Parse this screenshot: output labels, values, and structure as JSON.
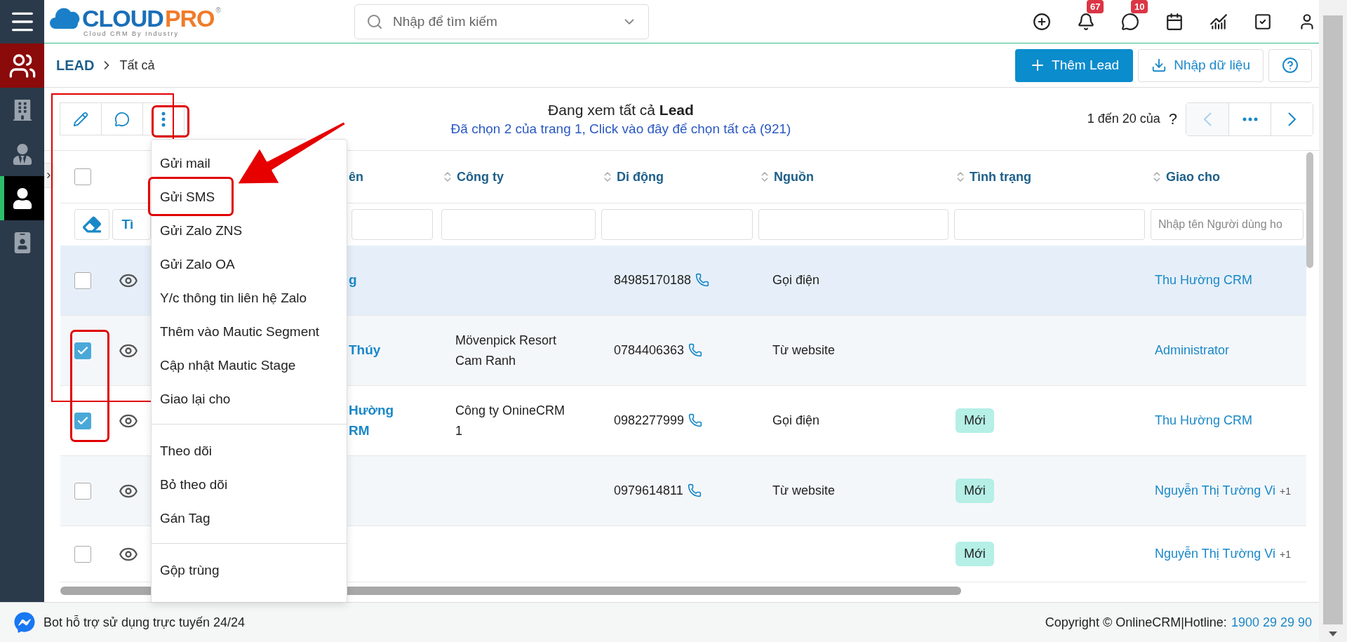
{
  "sidebar": {
    "items": [
      {
        "kind": "module",
        "selected": false
      },
      {
        "kind": "link",
        "selected": false
      },
      {
        "kind": "link",
        "selected": false
      },
      {
        "kind": "link",
        "selected": true
      },
      {
        "kind": "link",
        "selected": false
      }
    ]
  },
  "header": {
    "logo": {
      "brand_1": "CLOUD",
      "brand_2": "PRO",
      "mark": "®",
      "tagline": "Cloud CRM By Industry"
    },
    "search": {
      "placeholder": "Nhập để tìm kiếm"
    },
    "actions": [
      {
        "kind": "add"
      },
      {
        "kind": "notifications",
        "badge": "67"
      },
      {
        "kind": "messages",
        "badge": "10"
      },
      {
        "kind": "calendar"
      },
      {
        "kind": "reports"
      },
      {
        "kind": "tasks"
      },
      {
        "kind": "account"
      }
    ]
  },
  "breadcrumb": {
    "module": "LEAD",
    "current": "Tất cả"
  },
  "page_buttons": {
    "add": "Thêm Lead",
    "import": "Nhập dữ liệu"
  },
  "toolbar": {
    "actions": [
      {
        "kind": "edit"
      },
      {
        "kind": "comment"
      },
      {
        "kind": "more"
      }
    ],
    "viewing": "Đang xem tất cả **Lead**",
    "selection": "Đã chọn 2 của trang 1, Click vào đây để chọn tất cả (921)",
    "range": "1 đến 20 của",
    "total": "?",
    "prev_disabled": true
  },
  "more_menu": {
    "expanded": true,
    "groups": [
      [
        "Gửi mail",
        "Gửi SMS",
        "Gửi Zalo ZNS",
        "Gửi Zalo OA",
        "Y/c thông tin liên hệ Zalo",
        "Thêm vào Mautic Segment",
        "Cập nhật Mautic Stage",
        "Giao lại cho"
      ],
      [
        "Theo dõi",
        "Bỏ theo dõi",
        "Gán Tag"
      ],
      [
        "Gộp trùng"
      ]
    ]
  },
  "table": {
    "select_all_checked": false,
    "columns": [
      {
        "label": "ên"
      },
      {
        "label": "Công ty"
      },
      {
        "label": "Di động"
      },
      {
        "label": "Nguồn"
      },
      {
        "label": "Tình trạng"
      },
      {
        "label": "Giao cho"
      }
    ],
    "filters": {
      "search_button": "Tì",
      "assignee_placeholder": "Nhập tên Người dùng ho"
    },
    "rows": [
      {
        "checked": false,
        "hovered": true,
        "name": [
          "g"
        ],
        "phone": "84985170188",
        "source": "Gọi điện",
        "assignee": "Thu Hường CRM"
      },
      {
        "checked": true,
        "hovered": false,
        "name": [
          "Thúy"
        ],
        "company": [
          "Mövenpick Resort",
          "Cam Ranh"
        ],
        "phone": "0784406363",
        "source": "Từ website",
        "assignee": "Administrator"
      },
      {
        "checked": true,
        "hovered": false,
        "name": [
          "Hường",
          "RM"
        ],
        "company": [
          "Công ty OnineCRM",
          "1"
        ],
        "phone": "0982277999",
        "source": "Gọi điện",
        "status": "Mới",
        "assignee": "Thu Hường CRM"
      },
      {
        "checked": false,
        "hovered": false,
        "phone": "0979614811",
        "source": "Từ website",
        "status": "Mới",
        "assignee": "Nguyễn Thị Tường Vi",
        "assignee_more": "+1"
      },
      {
        "checked": false,
        "hovered": false,
        "status": "Mới",
        "assignee": "Nguyễn Thị Tường Vi",
        "assignee_more": "+1"
      }
    ]
  },
  "footer": {
    "bot": "Bot hỗ trợ sử dụng trực tuyến 24/24",
    "copyright": "Copyright © OnlineCRM|Hotline:",
    "hotline": "1900 29 29 90"
  }
}
